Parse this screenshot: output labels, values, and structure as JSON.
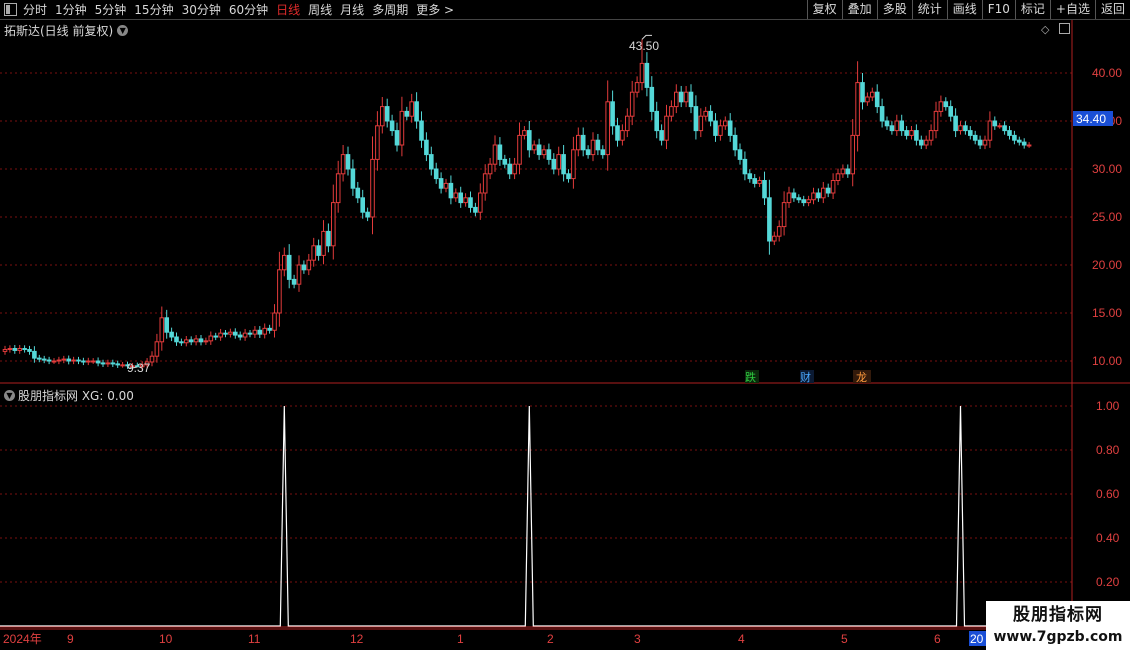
{
  "toolbar": {
    "periods": [
      "分时",
      "1分钟",
      "5分钟",
      "15分钟",
      "30分钟",
      "60分钟",
      "日线",
      "周线",
      "月线",
      "多周期",
      "更多 >"
    ],
    "active_period": "日线",
    "right_buttons": [
      "复权",
      "叠加",
      "多股",
      "统计",
      "画线",
      "F10",
      "标记",
      "+自选",
      "返回"
    ]
  },
  "main_chart": {
    "title": "拓斯达(日线 前复权)",
    "price_axis": [
      "40.00",
      "35.00",
      "30.00",
      "25.00",
      "20.00",
      "15.00",
      "10.00"
    ],
    "current_price": "34.40",
    "high_label": "43.50",
    "low_label": "9.37",
    "event_markers": [
      {
        "text": "跌",
        "color": "#2ecc40"
      },
      {
        "text": "财",
        "color": "#4aa8ff"
      },
      {
        "text": "龙",
        "color": "#ff9a3c"
      }
    ],
    "colors": {
      "up": "#e23b3b",
      "down": "#54d8d8",
      "grid": "#7a1010",
      "axis": "#b02020"
    }
  },
  "indicator": {
    "title": "股朋指标网 XG: 0.00",
    "axis": [
      "1.00",
      "0.80",
      "0.60",
      "0.40",
      "0.20"
    ]
  },
  "time_axis": {
    "labels": [
      "2024年",
      "9",
      "10",
      "11",
      "12",
      "1",
      "2",
      "3",
      "4",
      "5",
      "6",
      "20"
    ]
  },
  "watermark": {
    "line1": "股朋指标网",
    "line2": "www.7gpzb.com"
  },
  "chart_data": [
    {
      "type": "candlestick",
      "title": "拓斯达(日线 前复权)",
      "y_ticks": [
        40,
        35,
        30,
        25,
        20,
        15,
        10
      ],
      "ylim": [
        7.9,
        45.5
      ],
      "annotations": {
        "max": 43.5,
        "min": 9.37,
        "last": 34.4
      },
      "start_close": 11.0,
      "closes": [
        11.2,
        11.3,
        11.1,
        11.3,
        11.2,
        11.0,
        10.3,
        10.2,
        10.1,
        10.0,
        10.0,
        10.1,
        10.2,
        10.0,
        10.1,
        10.0,
        9.9,
        10.0,
        10.0,
        9.8,
        9.7,
        9.8,
        9.7,
        9.6,
        9.6,
        9.5,
        9.5,
        9.4,
        9.6,
        9.9,
        10.5,
        12.0,
        14.5,
        13.0,
        12.5,
        12.0,
        11.9,
        12.2,
        12.0,
        12.3,
        12.0,
        12.1,
        12.6,
        12.5,
        12.9,
        12.8,
        13.0,
        12.7,
        12.5,
        12.9,
        12.8,
        13.2,
        12.8,
        13.4,
        13.2,
        15.0,
        19.5,
        21.0,
        18.5,
        18.0,
        20.0,
        19.5,
        20.5,
        22.0,
        21.0,
        23.5,
        22.0,
        26.5,
        29.5,
        31.5,
        30.0,
        28.0,
        27.0,
        25.5,
        25.0,
        31.0,
        34.5,
        36.5,
        35.0,
        34.0,
        32.5,
        36.0,
        35.5,
        37.0,
        35.0,
        33.0,
        31.5,
        30.0,
        29.0,
        28.0,
        28.5,
        27.0,
        27.5,
        26.5,
        27.0,
        26.0,
        25.5,
        27.5,
        29.5,
        30.5,
        32.5,
        31.0,
        30.5,
        29.5,
        30.5,
        33.5,
        34.0,
        32.0,
        32.5,
        31.5,
        32.0,
        31.0,
        30.0,
        31.5,
        29.5,
        29.0,
        32.0,
        33.5,
        32.0,
        31.5,
        33.0,
        32.0,
        31.5,
        37.0,
        34.5,
        33.0,
        34.0,
        35.5,
        38.0,
        39.0,
        41.0,
        38.5,
        36.0,
        34.0,
        33.0,
        35.5,
        36.5,
        38.0,
        37.0,
        38.0,
        36.5,
        34.0,
        35.5,
        36.0,
        35.0,
        33.5,
        34.5,
        35.0,
        33.5,
        32.0,
        31.0,
        29.5,
        29.0,
        28.5,
        28.8,
        27.0,
        22.5,
        23.0,
        24.0,
        26.5,
        27.5,
        27.0,
        26.8,
        26.5,
        26.8,
        27.5,
        27.0,
        28.0,
        27.5,
        28.8,
        29.5,
        30.0,
        29.5,
        33.5,
        39.0,
        37.0,
        37.5,
        38.0,
        36.5,
        35.0,
        34.5,
        34.0,
        35.0,
        34.0,
        33.5,
        34.0,
        33.0,
        32.5,
        33.0,
        34.0,
        36.0,
        37.0,
        36.5,
        35.5,
        34.0,
        34.5,
        34.0,
        33.5,
        33.0,
        32.5,
        33.0,
        35.0,
        34.5,
        34.5,
        34.0,
        33.5,
        33.0,
        32.8,
        32.5,
        32.5
      ]
    },
    {
      "type": "line",
      "title": "股朋指标网 XG",
      "y_ticks": [
        1.0,
        0.8,
        0.6,
        0.4,
        0.2
      ],
      "ylim": [
        0,
        1.02
      ],
      "signal_bars": [
        57,
        107,
        195
      ],
      "value": 0.0
    }
  ]
}
